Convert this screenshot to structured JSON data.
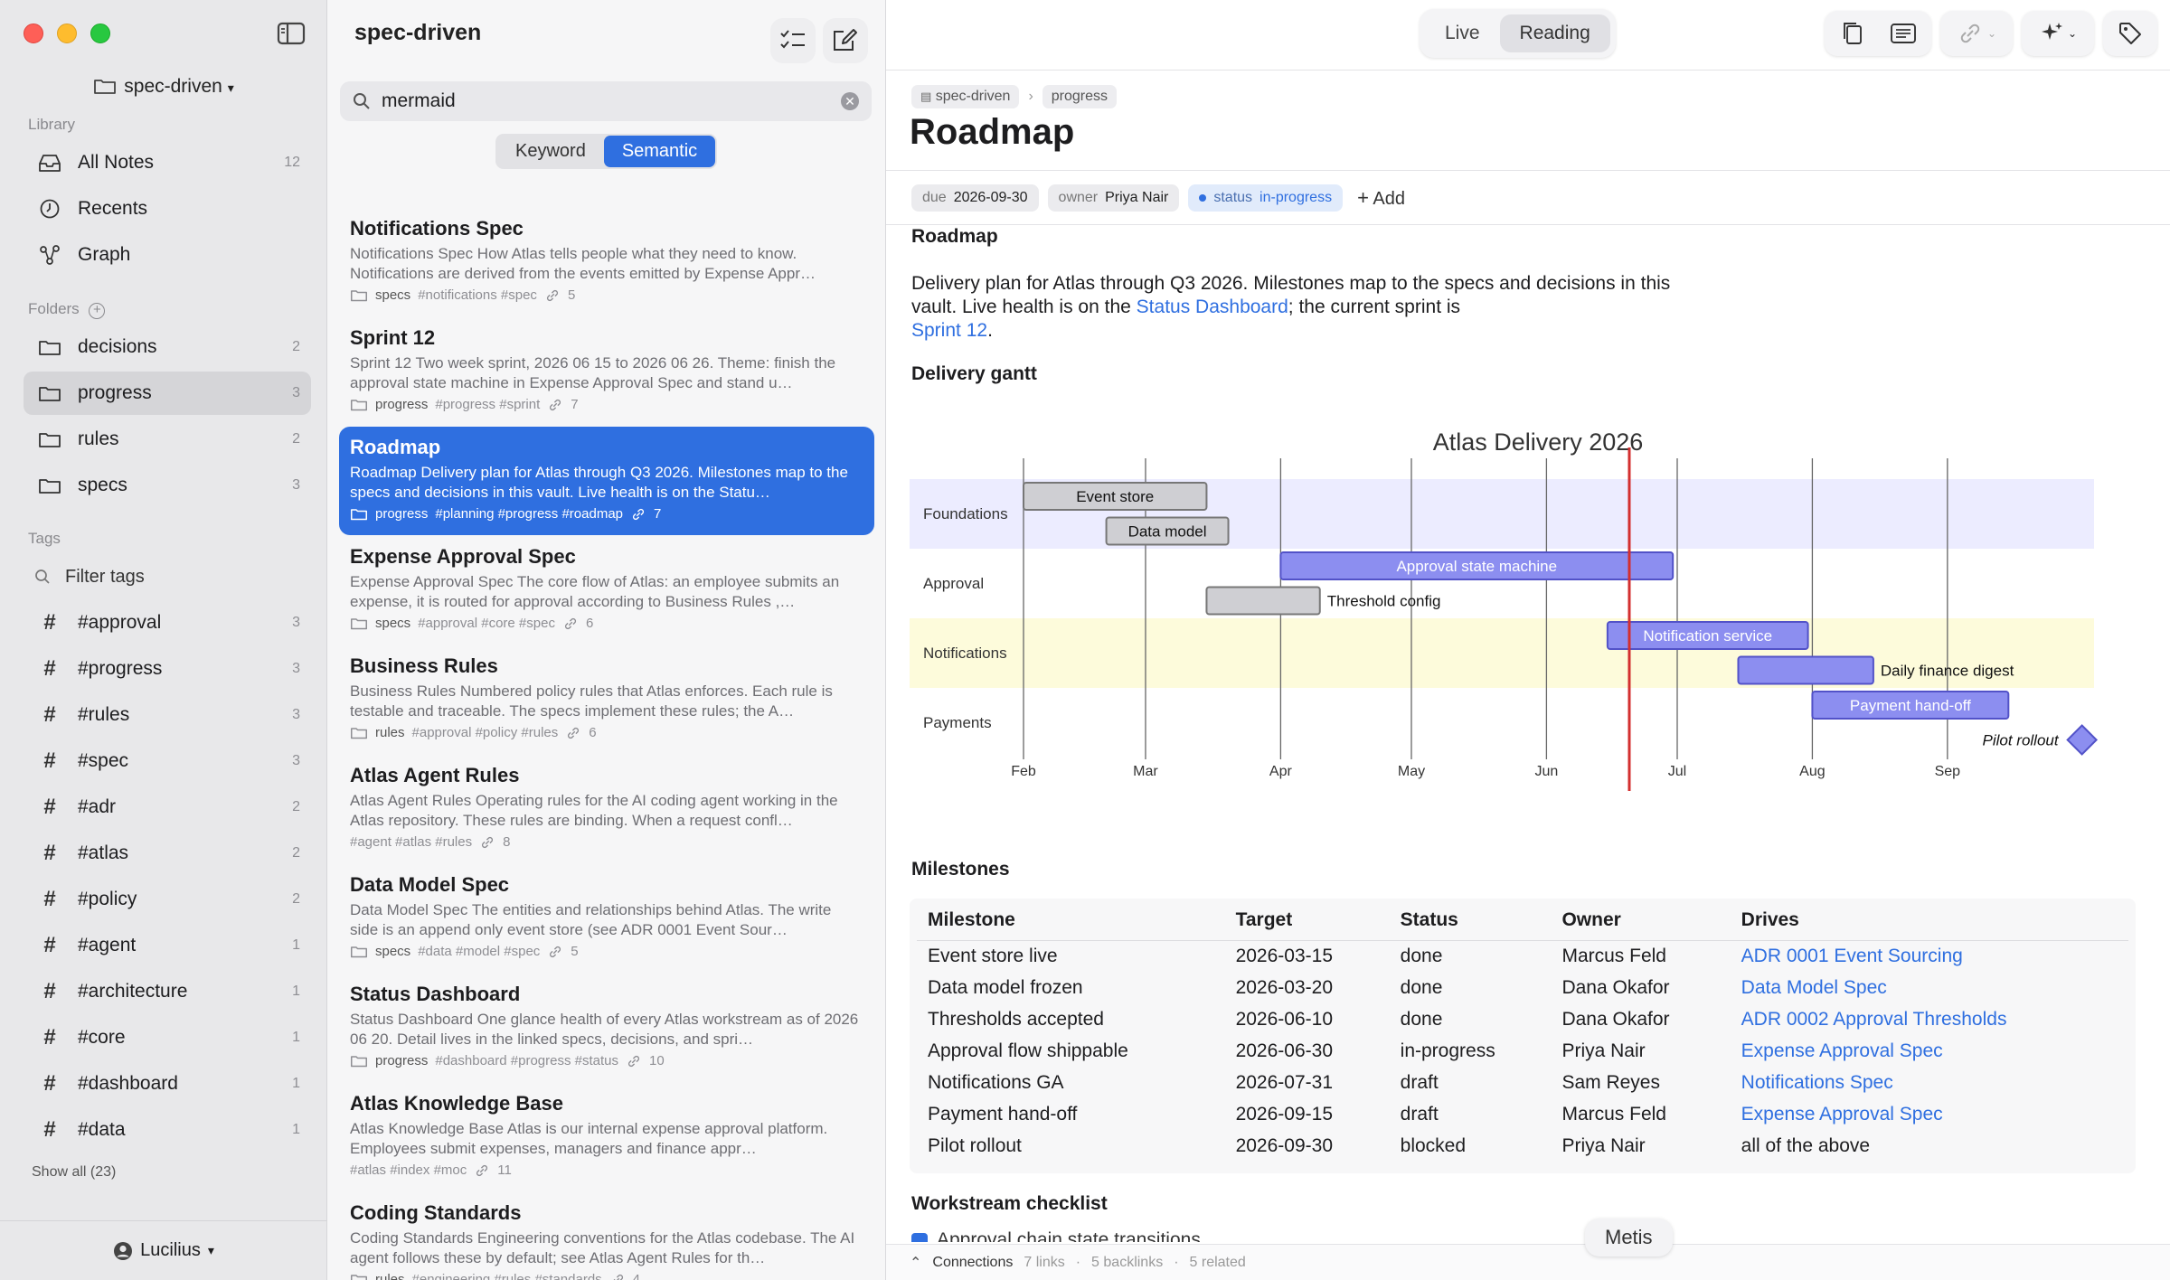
{
  "sidebar": {
    "vault": "spec-driven",
    "library_label": "Library",
    "library": [
      {
        "label": "All Notes",
        "count": "12"
      },
      {
        "label": "Recents"
      },
      {
        "label": "Graph"
      }
    ],
    "folders_label": "Folders",
    "folders": [
      {
        "label": "decisions",
        "count": "2"
      },
      {
        "label": "progress",
        "count": "3"
      },
      {
        "label": "rules",
        "count": "2"
      },
      {
        "label": "specs",
        "count": "3"
      }
    ],
    "tags_label": "Tags",
    "filter_placeholder": "Filter tags",
    "tags": [
      {
        "label": "#approval",
        "count": "3"
      },
      {
        "label": "#progress",
        "count": "3"
      },
      {
        "label": "#rules",
        "count": "3"
      },
      {
        "label": "#spec",
        "count": "3"
      },
      {
        "label": "#adr",
        "count": "2"
      },
      {
        "label": "#atlas",
        "count": "2"
      },
      {
        "label": "#policy",
        "count": "2"
      },
      {
        "label": "#agent",
        "count": "1"
      },
      {
        "label": "#architecture",
        "count": "1"
      },
      {
        "label": "#core",
        "count": "1"
      },
      {
        "label": "#dashboard",
        "count": "1"
      },
      {
        "label": "#data",
        "count": "1"
      }
    ],
    "show_all": "Show all (23)",
    "user": "Lucilius"
  },
  "notes": {
    "title": "spec-driven",
    "search_value": "mermaid",
    "modes": [
      "Keyword",
      "Semantic"
    ],
    "active_mode": "Semantic",
    "items": [
      {
        "title": "Notifications Spec",
        "snippet": "Notifications Spec How Atlas tells people what they need to know. Notifications are derived from the events emitted by Expense Appr…",
        "folder": "specs",
        "tags": "#notifications #spec",
        "links": "5"
      },
      {
        "title": "Sprint 12",
        "snippet": "Sprint 12 Two week sprint, 2026 06 15 to 2026 06 26. Theme: finish the approval state machine in Expense Approval Spec and stand u…",
        "folder": "progress",
        "tags": "#progress #sprint",
        "links": "7"
      },
      {
        "title": "Roadmap",
        "snippet": "Roadmap Delivery plan for Atlas through Q3 2026. Milestones map to the specs and decisions in this vault. Live health is on the Statu…",
        "folder": "progress",
        "tags": "#planning #progress #roadmap",
        "links": "7"
      },
      {
        "title": "Expense Approval Spec",
        "snippet": "Expense Approval Spec The core flow of Atlas: an employee submits an expense, it is routed for approval according to Business Rules ,…",
        "folder": "specs",
        "tags": "#approval #core #spec",
        "links": "6"
      },
      {
        "title": "Business Rules",
        "snippet": "Business Rules Numbered policy rules that Atlas enforces. Each rule is testable and traceable. The specs implement these rules; the A…",
        "folder": "rules",
        "tags": "#approval #policy #rules",
        "links": "6"
      },
      {
        "title": "Atlas Agent Rules",
        "snippet": "Atlas Agent Rules Operating rules for the AI coding agent working in the Atlas repository. These rules are binding. When a request confl…",
        "folder": "",
        "tags": "#agent #atlas #rules",
        "links": "8"
      },
      {
        "title": "Data Model Spec",
        "snippet": "Data Model Spec The entities and relationships behind Atlas. The write side is an append only event store (see ADR 0001 Event Sour…",
        "folder": "specs",
        "tags": "#data #model #spec",
        "links": "5"
      },
      {
        "title": "Status Dashboard",
        "snippet": "Status Dashboard One glance health of every Atlas workstream as of 2026 06 20. Detail lives in the linked specs, decisions, and spri…",
        "folder": "progress",
        "tags": "#dashboard #progress #status",
        "links": "10"
      },
      {
        "title": "Atlas Knowledge Base",
        "snippet": "Atlas Knowledge Base Atlas is our internal expense approval platform. Employees submit expenses, managers and finance appr…",
        "folder": "",
        "tags": "#atlas #index #moc",
        "links": "11"
      },
      {
        "title": "Coding Standards",
        "snippet": "Coding Standards Engineering conventions for the Atlas codebase. The AI agent follows these by default; see Atlas Agent Rules for th…",
        "folder": "rules",
        "tags": "#engineering #rules #standards",
        "links": "4"
      }
    ]
  },
  "main": {
    "view_modes": [
      "Live",
      "Reading"
    ],
    "active_view": "Reading",
    "breadcrumb": [
      "spec-driven",
      "progress"
    ],
    "title": "Roadmap",
    "props": {
      "due_key": "due",
      "due": "2026-09-30",
      "owner_key": "owner",
      "owner": "Priya Nair",
      "status_key": "status",
      "status": "in-progress",
      "add": "Add"
    },
    "section_heading": "Roadmap",
    "para_1": "Delivery plan for Atlas through Q3 2026. Milestones map to the specs and decisions in this vault. Live health is on the ",
    "para_link1": "Status Dashboard",
    "para_2": "; the current sprint is",
    "para_link2": "Sprint 12",
    "para_end": ".",
    "gantt_heading": "Delivery gantt",
    "milestones_heading": "Milestones",
    "checklist_heading": "Workstream checklist",
    "checklist_partial": "Approval chain state transitions",
    "table": {
      "headers": [
        "Milestone",
        "Target",
        "Status",
        "Owner",
        "Drives"
      ],
      "rows": [
        [
          "Event store live",
          "2026-03-15",
          "done",
          "Marcus Feld",
          "ADR 0001 Event Sourcing"
        ],
        [
          "Data model frozen",
          "2026-03-20",
          "done",
          "Dana Okafor",
          "Data Model Spec"
        ],
        [
          "Thresholds accepted",
          "2026-06-10",
          "done",
          "Dana Okafor",
          "ADR 0002 Approval Thresholds"
        ],
        [
          "Approval flow shippable",
          "2026-06-30",
          "in-progress",
          "Priya Nair",
          "Expense Approval Spec"
        ],
        [
          "Notifications GA",
          "2026-07-31",
          "draft",
          "Sam Reyes",
          "Notifications Spec"
        ],
        [
          "Payment hand-off",
          "2026-09-15",
          "draft",
          "Marcus Feld",
          "Expense Approval Spec"
        ],
        [
          "Pilot rollout",
          "2026-09-30",
          "blocked",
          "Priya Nair",
          "all of the above"
        ]
      ],
      "link_rows": [
        0,
        1,
        2,
        3,
        4,
        5
      ]
    },
    "connections": {
      "label": "Connections",
      "links": "7 links",
      "backlinks": "5 backlinks",
      "related": "5 related"
    },
    "assistant": "Metis"
  },
  "colors": {
    "accent": "#2f6fe0",
    "task": "#8c8ef0",
    "task_stroke": "#5252c8",
    "done": "#cfcfd3",
    "today": "#d32f2f",
    "band_a": "#ececff",
    "band_b": "#fdfbdb"
  },
  "chart_data": {
    "type": "gantt",
    "title": "Atlas Delivery 2026",
    "x_ticks": [
      "Feb",
      "Mar",
      "Apr",
      "May",
      "Jun",
      "Jul",
      "Aug",
      "Sep"
    ],
    "today": "2026-06-20",
    "sections": [
      "Foundations",
      "Approval",
      "Notifications",
      "Payments"
    ],
    "tasks": [
      {
        "name": "Event store",
        "section": "Foundations",
        "start": "2026-02-01",
        "end": "2026-03-15",
        "status": "done"
      },
      {
        "name": "Data model",
        "section": "Foundations",
        "start": "2026-02-20",
        "end": "2026-03-20",
        "status": "done"
      },
      {
        "name": "Approval state machine",
        "section": "Approval",
        "start": "2026-04-01",
        "end": "2026-06-30",
        "status": "active"
      },
      {
        "name": "Threshold config",
        "section": "Approval",
        "start": "2026-03-15",
        "end": "2026-04-10",
        "status": "done"
      },
      {
        "name": "Notification service",
        "section": "Notifications",
        "start": "2026-06-15",
        "end": "2026-07-31",
        "status": "active"
      },
      {
        "name": "Daily finance digest",
        "section": "Notifications",
        "start": "2026-07-15",
        "end": "2026-08-15",
        "status": "active"
      },
      {
        "name": "Payment hand-off",
        "section": "Payments",
        "start": "2026-08-01",
        "end": "2026-09-15",
        "status": "active"
      },
      {
        "name": "Pilot rollout",
        "section": "Payments",
        "start": "2026-09-30",
        "end": "2026-09-30",
        "status": "milestone"
      }
    ]
  }
}
